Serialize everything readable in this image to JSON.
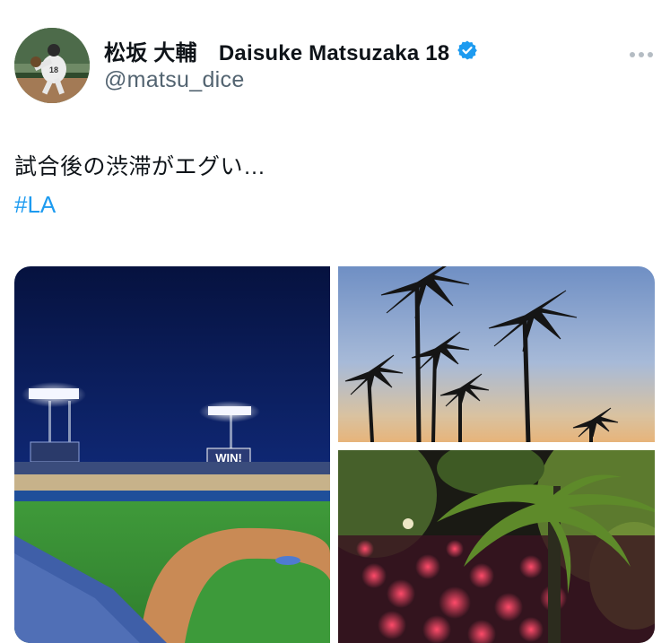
{
  "user": {
    "display_name": "松坂 大輔　Daisuke Matsuzaka 18",
    "handle": "@matsu_dice",
    "avatar_number": "18",
    "verified": true
  },
  "tweet": {
    "text": "試合後の渋滞がエグい…",
    "hashtag": "#LA"
  },
  "media": {
    "stadium_sign": "WIN!"
  },
  "colors": {
    "verified_badge": "#1d9bf0",
    "hashtag": "#1d9bf0",
    "handle": "#536471",
    "text": "#0f1419"
  },
  "icons": [
    "verified-badge-icon",
    "more-options-icon"
  ]
}
